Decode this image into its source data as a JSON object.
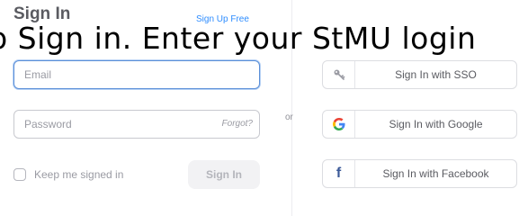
{
  "header": {
    "title": "Sign In",
    "signup_link": "Sign Up Free"
  },
  "overlay": {
    "text": "o Sign in. Enter your StMU login"
  },
  "form": {
    "email_placeholder": "Email",
    "password_placeholder": "Password",
    "forgot_label": "Forgot?",
    "keep_signed_in_label": "Keep me signed in",
    "signin_button": "Sign In"
  },
  "divider": {
    "or_label": "or"
  },
  "sso_buttons": [
    {
      "label": "Sign In with SSO",
      "icon": "key-icon"
    },
    {
      "label": "Sign In with Google",
      "icon": "google-icon"
    },
    {
      "label": "Sign In with Facebook",
      "icon": "facebook-icon"
    }
  ],
  "colors": {
    "link": "#2d8cff",
    "focus_border": "#5b8fd8",
    "google_blue": "#4285f4",
    "facebook_blue": "#3b5998"
  }
}
